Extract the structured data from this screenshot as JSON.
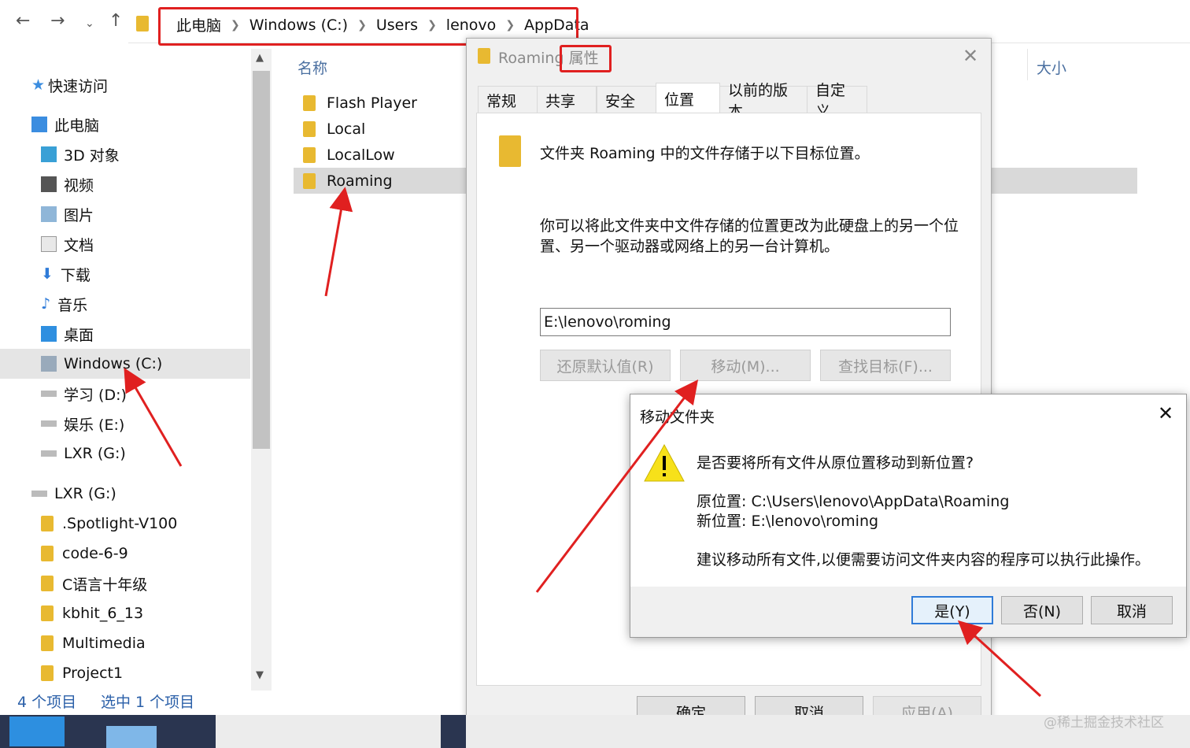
{
  "explorer": {
    "breadcrumb": [
      "此电脑",
      "Windows (C:)",
      "Users",
      "lenovo",
      "AppData"
    ],
    "columns": {
      "name": "名称",
      "size": "大小"
    },
    "nav": {
      "quick_access": "快速访问",
      "this_pc": "此电脑",
      "items": [
        "3D 对象",
        "视频",
        "图片",
        "文档",
        "下载",
        "音乐",
        "桌面",
        "Windows (C:)",
        "学习 (D:)",
        "娱乐 (E:)",
        "LXR (G:)"
      ],
      "drive": "LXR (G:)",
      "drive_items": [
        ".Spotlight-V100",
        "code-6-9",
        "C语言十年级",
        "kbhit_6_13",
        "Multimedia",
        "Project1"
      ]
    },
    "files": [
      "Flash Player",
      "Local",
      "LocalLow",
      "Roaming"
    ],
    "status": {
      "count": "4 个项目",
      "selected": "选中 1 个项目"
    }
  },
  "properties": {
    "title_name": "Roaming",
    "title_suffix": "属性",
    "tabs": [
      "常规",
      "共享",
      "安全",
      "位置",
      "以前的版本",
      "自定义"
    ],
    "active_tab": "位置",
    "intro": "文件夹 Roaming 中的文件存储于以下目标位置。",
    "desc": "你可以将此文件夹中文件存储的位置更改为此硬盘上的另一个位置、另一个驱动器或网络上的另一台计算机。",
    "path_value": "E:\\lenovo\\roming",
    "buttons": {
      "restore": "还原默认值(R)",
      "move": "移动(M)...",
      "find": "查找目标(F)..."
    },
    "footer": {
      "ok": "确定",
      "cancel": "取消",
      "apply": "应用(A)"
    }
  },
  "move_dialog": {
    "title": "移动文件夹",
    "question": "是否要将所有文件从原位置移动到新位置?",
    "from": "原位置: C:\\Users\\lenovo\\AppData\\Roaming",
    "to": "新位置: E:\\lenovo\\roming",
    "advice": "建议移动所有文件,以便需要访问文件夹内容的程序可以执行此操作。",
    "buttons": {
      "yes": "是(Y)",
      "no": "否(N)",
      "cancel": "取消"
    }
  },
  "watermark": "@稀土掘金技术社区",
  "colors": {
    "annotation_red": "#e02020",
    "folder": "#e8b931",
    "selection": "#d9d9d9",
    "accent_blue": "#2f7bd8"
  }
}
